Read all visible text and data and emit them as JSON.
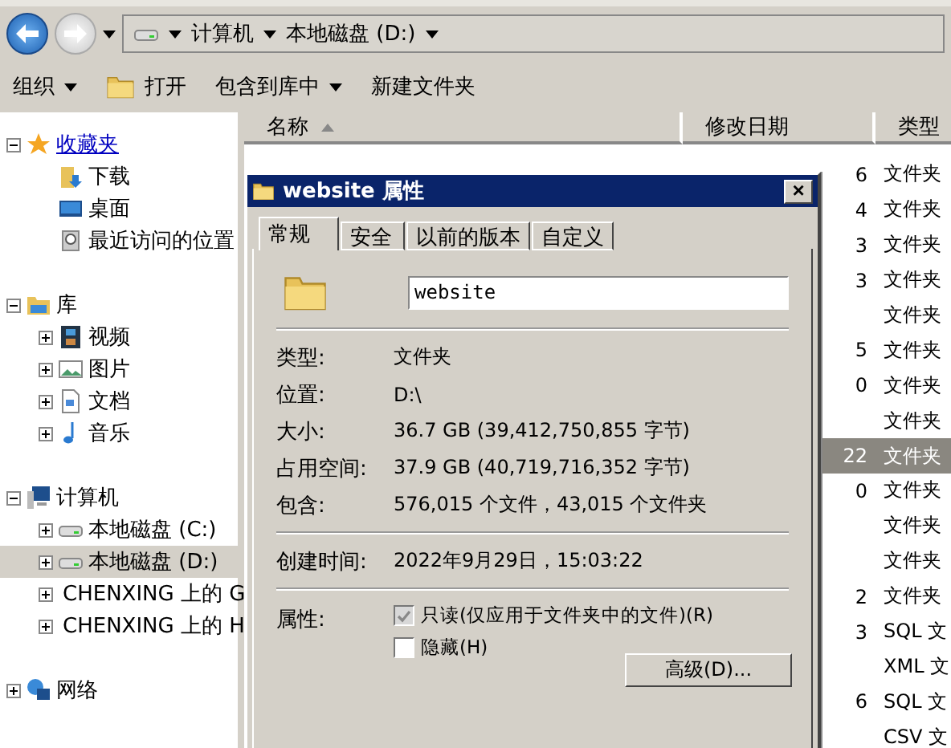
{
  "address_bar": {
    "segments": [
      "计算机",
      "本地磁盘 (D:)"
    ]
  },
  "toolbar": [
    {
      "label": "组织",
      "dropdown": true,
      "icon": false
    },
    {
      "label": "打开",
      "dropdown": false,
      "icon": true
    },
    {
      "label": "包含到库中",
      "dropdown": true,
      "icon": false
    },
    {
      "label": "新建文件夹",
      "dropdown": false,
      "icon": false
    }
  ],
  "nav_tree": [
    {
      "label": "收藏夹",
      "kind": "star",
      "expanded": true,
      "selected": false,
      "link": true,
      "children": [
        {
          "label": "下载",
          "kind": "download",
          "link": false,
          "selected": false
        },
        {
          "label": "桌面",
          "kind": "desktop",
          "link": false,
          "selected": false
        },
        {
          "label": "最近访问的位置",
          "kind": "recent",
          "link": false,
          "selected": false
        }
      ]
    },
    {
      "label": "库",
      "kind": "library",
      "expanded": true,
      "selected": false,
      "link": false,
      "children": [
        {
          "label": "视频",
          "kind": "video",
          "expanded": false,
          "link": false,
          "selected": false
        },
        {
          "label": "图片",
          "kind": "image",
          "expanded": false,
          "link": false,
          "selected": false
        },
        {
          "label": "文档",
          "kind": "document",
          "expanded": false,
          "link": false,
          "selected": false
        },
        {
          "label": "音乐",
          "kind": "music",
          "expanded": false,
          "link": false,
          "selected": false
        }
      ]
    },
    {
      "label": "计算机",
      "kind": "computer",
      "expanded": true,
      "selected": false,
      "link": false,
      "children": [
        {
          "label": "本地磁盘 (C:)",
          "kind": "drive",
          "expanded": false,
          "link": false,
          "selected": false
        },
        {
          "label": "本地磁盘 (D:)",
          "kind": "drive",
          "expanded": false,
          "link": false,
          "selected": true
        },
        {
          "label": "CHENXING 上的 G",
          "kind": "netdrive",
          "expanded": false,
          "link": false,
          "selected": false
        },
        {
          "label": "CHENXING 上的 H",
          "kind": "netdrive",
          "expanded": false,
          "link": false,
          "selected": false
        }
      ]
    },
    {
      "label": "网络",
      "kind": "network",
      "expanded": false,
      "selected": false,
      "link": false
    }
  ],
  "file_list": {
    "columns": [
      "名称",
      "修改日期",
      "类型"
    ],
    "rows": [
      {
        "date_visible": "6",
        "type": "文件夹",
        "selected": false
      },
      {
        "date_visible": "4",
        "type": "文件夹",
        "selected": false
      },
      {
        "date_visible": "3",
        "type": "文件夹",
        "selected": false
      },
      {
        "date_visible": "3",
        "type": "文件夹",
        "selected": false
      },
      {
        "type": "文件夹",
        "selected": false
      },
      {
        "date_visible": "5",
        "type": "文件夹",
        "selected": false
      },
      {
        "date_visible": "0",
        "type": "文件夹",
        "selected": false
      },
      {
        "type": "文件夹",
        "selected": false
      },
      {
        "date_visible": "22",
        "type": "文件夹",
        "selected": true
      },
      {
        "date_visible": "0",
        "type": "文件夹",
        "selected": false
      },
      {
        "type": "文件夹",
        "selected": false
      },
      {
        "type": "文件夹",
        "selected": false
      },
      {
        "date_visible": "2",
        "type": "文件夹",
        "selected": false
      },
      {
        "date_visible": "3",
        "type": "SQL 文",
        "selected": false
      },
      {
        "type": "XML 文",
        "selected": false
      },
      {
        "date_visible": "6",
        "type": "SQL 文",
        "selected": false
      },
      {
        "type": "CSV 文",
        "selected": false
      }
    ]
  },
  "dialog": {
    "title": "website 属性",
    "close": "×",
    "tabs": [
      {
        "label": "常规",
        "selected": true
      },
      {
        "label": "安全",
        "selected": false
      },
      {
        "label": "以前的版本",
        "selected": false
      },
      {
        "label": "自定义",
        "selected": false
      }
    ],
    "name_value": "website",
    "sections": [
      [
        {
          "label": "类型:",
          "value": "文件夹"
        },
        {
          "label": "位置:",
          "value": "D:\\"
        },
        {
          "label": "大小:",
          "value": "36.7 GB (39,412,750,855 字节)"
        },
        {
          "label": "占用空间:",
          "value": "37.9 GB (40,719,716,352 字节)"
        },
        {
          "label": "包含:",
          "value": "576,015 个文件，43,015 个文件夹"
        }
      ],
      [
        {
          "label": "创建时间:",
          "value": "2022年9月29日，15:03:22"
        }
      ]
    ],
    "attributes_label": "属性:",
    "attributes": [
      {
        "label": "只读(仅应用于文件夹中的文件)(R)",
        "checked": true,
        "indeterminate": true
      },
      {
        "label": "隐藏(H)",
        "checked": false,
        "indeterminate": false
      }
    ],
    "advanced_button": "高级(D)..."
  }
}
